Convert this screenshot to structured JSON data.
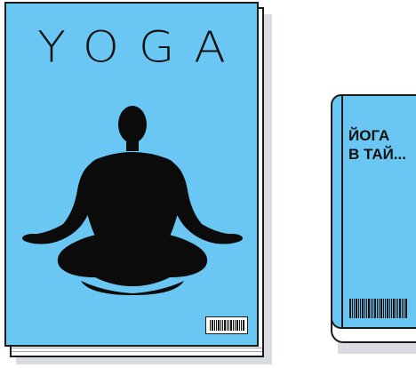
{
  "magazine": {
    "title": "YOGA",
    "cover_color": "#6ac6f2",
    "figure_icon": "meditation-silhouette"
  },
  "book": {
    "title_line1": "ЙОГА",
    "title_line2": "В ТАЙ...",
    "cover_color": "#6ac6f2"
  }
}
